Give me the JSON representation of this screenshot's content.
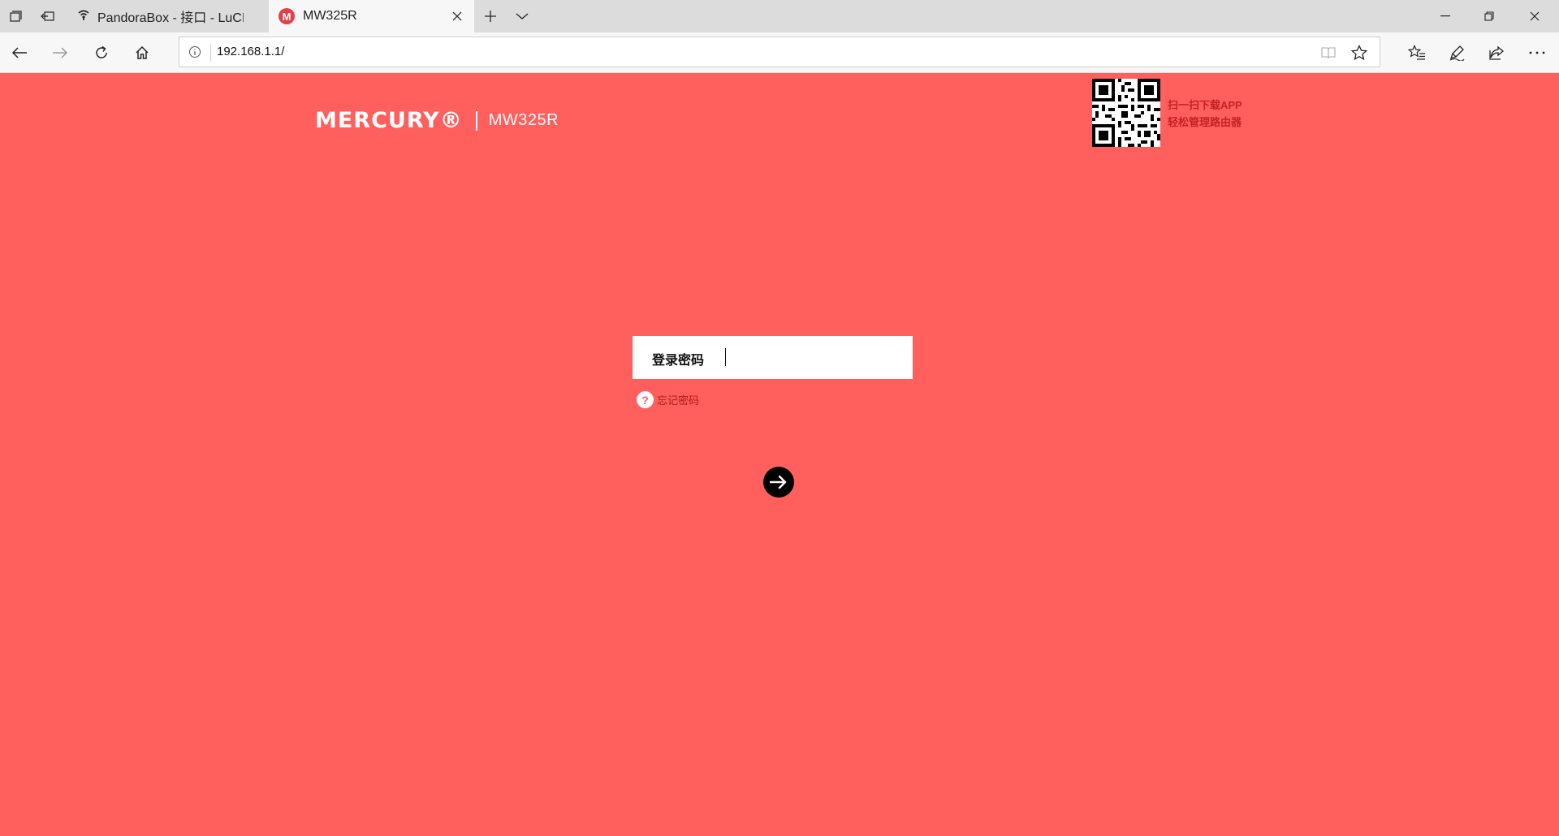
{
  "browser": {
    "tabs": [
      {
        "title": "PandoraBox - 接口 - LuCI",
        "icon": "wifi-favicon-icon",
        "active": false
      },
      {
        "title": "MW325R",
        "icon": "mercury-favicon-icon",
        "favicon_letter": "M",
        "active": true
      }
    ],
    "address": {
      "url": "192.168.1.1/"
    }
  },
  "page": {
    "background_color": "#ff5f5d",
    "brand": {
      "logo": "MERCURY®",
      "model": "MW325R"
    },
    "qr_promo": {
      "line1": "扫一扫下载APP",
      "line2": "轻松管理路由器",
      "text_color": "#c42224"
    },
    "login": {
      "label": "登录密码",
      "password_value": ""
    },
    "forgot": {
      "icon_char": "?",
      "label": "忘记密码"
    },
    "submit": {
      "icon": "arrow-right-icon"
    }
  }
}
